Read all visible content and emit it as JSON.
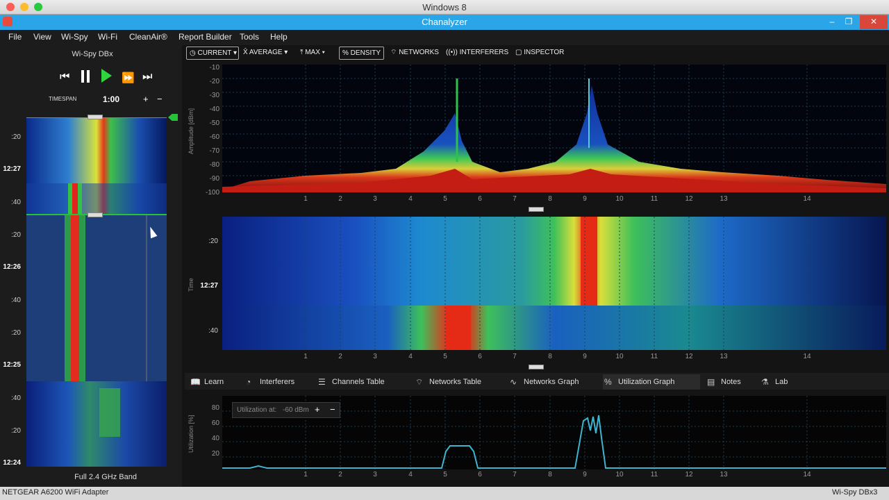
{
  "mac": {
    "title": "Windows 8"
  },
  "window": {
    "title": "Chanalyzer"
  },
  "menu": [
    "File",
    "View",
    "Wi-Spy",
    "Wi-Fi",
    "CleanAir®",
    "Report Builder",
    "Tools",
    "Help"
  ],
  "left": {
    "device": "Wi-Spy DBx",
    "timespan_label": "TIMESPAN",
    "timespan_value": "1:00",
    "plus": "+",
    "minus": "−",
    "ticks": [
      ":20",
      "12:27",
      ":40",
      ":20",
      "12:26",
      ":40",
      ":20",
      "12:25",
      ":40",
      ":20",
      "12:24"
    ],
    "band_label": "Full 2.4 GHz Band"
  },
  "toolbar": {
    "current": "CURRENT",
    "average": "AVERAGE",
    "max": "MAX",
    "density": "DENSITY",
    "networks": "NETWORKS",
    "interferers": "INTERFERERS",
    "inspector": "INSPECTOR"
  },
  "density_plot": {
    "axis_title": "Amplitude [dBm]",
    "y_ticks": [
      "-10",
      "-20",
      "-30",
      "-40",
      "-50",
      "-60",
      "-70",
      "-80",
      "-90",
      "-100"
    ],
    "x_ticks": [
      "1",
      "2",
      "3",
      "4",
      "5",
      "6",
      "7",
      "8",
      "9",
      "10",
      "11",
      "12",
      "13",
      "14"
    ]
  },
  "waterfall_plot": {
    "axis_title": "Time",
    "y_ticks": [
      ":20",
      "12:27",
      ":40"
    ],
    "x_ticks": [
      "1",
      "2",
      "3",
      "4",
      "5",
      "6",
      "7",
      "8",
      "9",
      "10",
      "11",
      "12",
      "13",
      "14"
    ]
  },
  "tabs": [
    "Learn",
    "Interferers",
    "Channels Table",
    "Networks Table",
    "Networks Graph",
    "Utilization Graph",
    "Notes",
    "Lab"
  ],
  "active_tab": "Utilization Graph",
  "util": {
    "axis_title": "Utilization [%]",
    "y_ticks": [
      "80",
      "60",
      "40",
      "20"
    ],
    "x_ticks": [
      "1",
      "2",
      "3",
      "4",
      "5",
      "6",
      "7",
      "8",
      "9",
      "10",
      "11",
      "12",
      "13",
      "14"
    ],
    "at_label": "Utilization at:",
    "at_value": "-60 dBm",
    "plus": "+",
    "minus": "−"
  },
  "status": {
    "left": "NETGEAR A6200 WiFi Adapter",
    "right": "Wi-Spy DBx3"
  },
  "colors": {
    "accent": "#2aa5e8",
    "util_line": "#3fb4d0",
    "grid": "#1f3f55",
    "marker": "#27c23a"
  }
}
